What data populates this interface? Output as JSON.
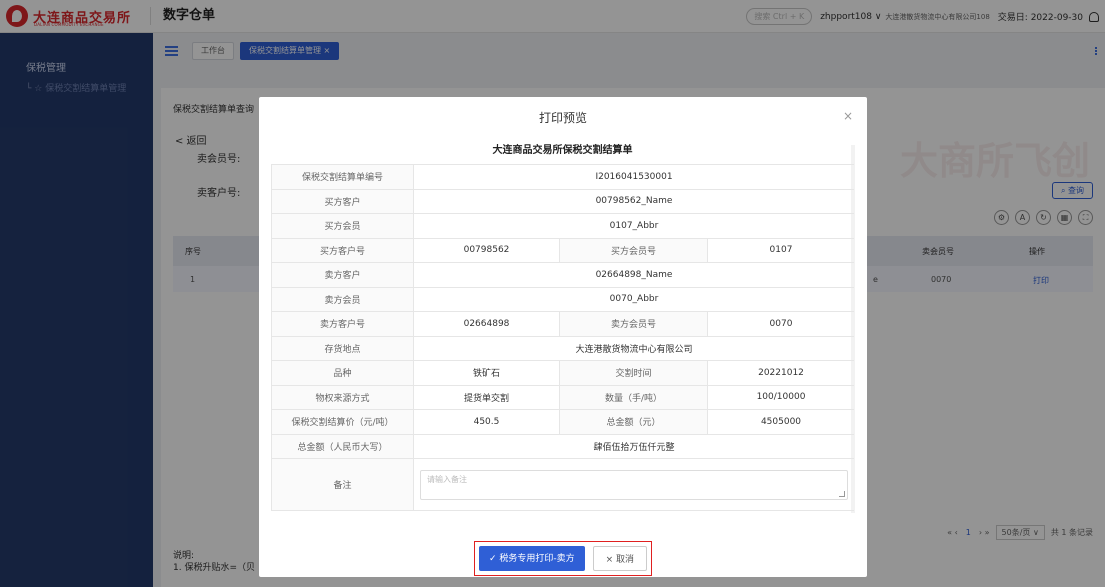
{
  "topbar": {
    "logo_text": "大连商品交易所",
    "logo_sub": "DALIAN COMMODITY EXCHANGE",
    "app_title": "数字仓单",
    "search_hint": "搜索 Ctrl + K",
    "user": "zhpport108 ∨",
    "company": "大连港散货物流中心有限公司108",
    "trade_day": "交易日: 2022-09-30"
  },
  "sidebar": {
    "group": "保税管理",
    "sub_item": "保税交割结算单管理"
  },
  "tabs": [
    {
      "label": "工作台"
    },
    {
      "label": "保税交割结算单管理 ×"
    }
  ],
  "content": {
    "breadcrumb": "保税交割结算单查询",
    "back": "< 返回",
    "field1_label": "卖会员号:",
    "field2_label": "卖客户号:",
    "query_btn": "查询",
    "table_headers": [
      "序号",
      "卖会员号",
      "操作"
    ],
    "row": {
      "index": "1",
      "suffix": "e",
      "seller_member": "0070",
      "action": "打印"
    },
    "pager": {
      "current": "1",
      "page_size": "50条/页 ∨",
      "total": "共 1 条记录"
    },
    "note_title": "说明:",
    "note_line": "1. 保税升贴水=（贝"
  },
  "modal": {
    "title": "打印预览",
    "doc_title": "大连商品交易所保税交割结算单",
    "rows": [
      {
        "label": "保税交割结算单编号",
        "value": "I2016041530001"
      },
      {
        "label": "买方客户",
        "value": "00798562_Name"
      },
      {
        "label": "买方会员",
        "value": "0107_Abbr"
      },
      {
        "label": "买方客户号",
        "value": "00798562",
        "label2": "买方会员号",
        "value2": "0107"
      },
      {
        "label": "卖方客户",
        "value": "02664898_Name"
      },
      {
        "label": "卖方会员",
        "value": "0070_Abbr"
      },
      {
        "label": "卖方客户号",
        "value": "02664898",
        "label2": "卖方会员号",
        "value2": "0070"
      },
      {
        "label": "存货地点",
        "value": "大连港散货物流中心有限公司"
      },
      {
        "label": "品种",
        "value": "铁矿石",
        "label2": "交割时间",
        "value2": "20221012"
      },
      {
        "label": "物权来源方式",
        "value": "提货单交割",
        "label2": "数量（手/吨）",
        "value2": "100/10000"
      },
      {
        "label": "保税交割结算价（元/吨）",
        "value": "450.5",
        "label2": "总金额（元）",
        "value2": "4505000"
      },
      {
        "label": "总金额（人民币大写）",
        "value": "肆佰伍拾万伍仟元整"
      }
    ],
    "remark_label": "备注",
    "remark_placeholder": "请输入备注",
    "print_btn": "✓ 税务专用打印-卖方",
    "cancel_btn": "× 取消"
  }
}
